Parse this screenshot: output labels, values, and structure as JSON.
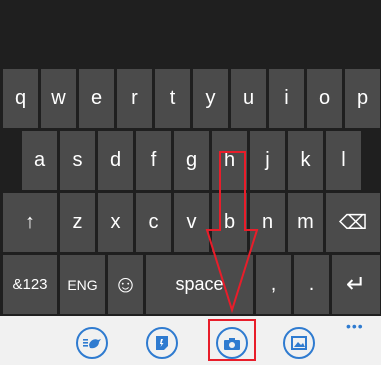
{
  "keyboard": {
    "row1": [
      "q",
      "w",
      "e",
      "r",
      "t",
      "y",
      "u",
      "i",
      "o",
      "p"
    ],
    "row2": [
      "a",
      "s",
      "d",
      "f",
      "g",
      "h",
      "j",
      "k",
      "l"
    ],
    "row3": {
      "shift": "↑",
      "letters": [
        "z",
        "x",
        "c",
        "v",
        "b",
        "n",
        "m"
      ],
      "backspace": "⌫"
    },
    "row4": {
      "numbers": "&123",
      "language": "ENG",
      "emoji": "☺",
      "space": "space",
      "comma": ",",
      "period": ".",
      "enter": "↵"
    }
  },
  "app_bar": {
    "more": "•••",
    "buttons": [
      "emoticon-bird-icon",
      "sticker-icon",
      "camera-icon",
      "gallery-icon"
    ],
    "accent_color": "#2f7bd0"
  },
  "annotation": {
    "color": "#e81d2a"
  }
}
